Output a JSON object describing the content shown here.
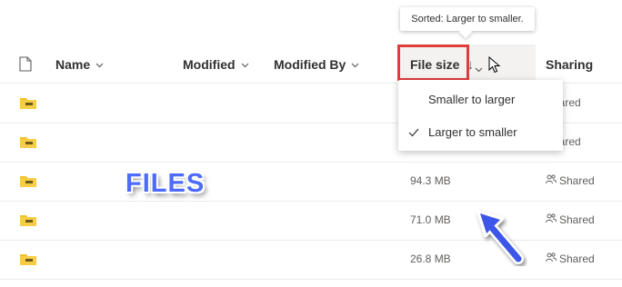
{
  "tooltip": {
    "text": "Sorted: Larger to smaller."
  },
  "header": {
    "name": "Name",
    "modified": "Modified",
    "modified_by": "Modified By",
    "file_size": "File size",
    "sort_arrow": "↓",
    "sharing": "Sharing"
  },
  "sort_menu": {
    "items": [
      "Smaller to larger",
      "Larger to smaller"
    ],
    "selected_index": 1
  },
  "rows": [
    {
      "size": "",
      "sharing": "Shared"
    },
    {
      "size": "",
      "sharing": "Shared"
    },
    {
      "size": "94.3 MB",
      "sharing": "Shared"
    },
    {
      "size": "71.0 MB",
      "sharing": "Shared"
    },
    {
      "size": "26.8 MB",
      "sharing": "Shared"
    }
  ],
  "annotation": {
    "label": "FILES",
    "arrow_color": "#3a56e8",
    "highlight_color": "#e03c3c"
  },
  "colors": {
    "folder": "#f2c12e",
    "folder_dark": "#d8a516",
    "accent_check": "#323130"
  }
}
